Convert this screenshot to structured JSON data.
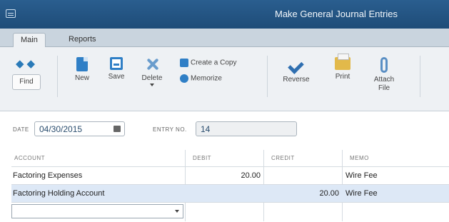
{
  "window": {
    "title": "Make General Journal Entries"
  },
  "tabs": [
    {
      "label": "Main"
    },
    {
      "label": "Reports"
    }
  ],
  "toolbar": {
    "find": "Find",
    "new": "New",
    "save": "Save",
    "delete": "Delete",
    "create_copy": "Create a Copy",
    "memorize": "Memorize",
    "reverse": "Reverse",
    "print": "Print",
    "attach_file": "Attach File"
  },
  "form": {
    "date_label": "DATE",
    "date_value": "04/30/2015",
    "entry_no_label": "ENTRY NO.",
    "entry_no_value": "14"
  },
  "grid": {
    "columns": [
      "ACCOUNT",
      "DEBIT",
      "CREDIT",
      "MEMO"
    ],
    "rows": [
      {
        "account": "Factoring Expenses",
        "debit": "20.00",
        "credit": "",
        "memo": "Wire Fee"
      },
      {
        "account": "Factoring Holding Account",
        "debit": "",
        "credit": "20.00",
        "memo": "Wire Fee"
      }
    ]
  },
  "colors": {
    "titlebar": "#2a5e8f",
    "accent": "#2f7fc6",
    "selected_row": "#dde8f6"
  }
}
